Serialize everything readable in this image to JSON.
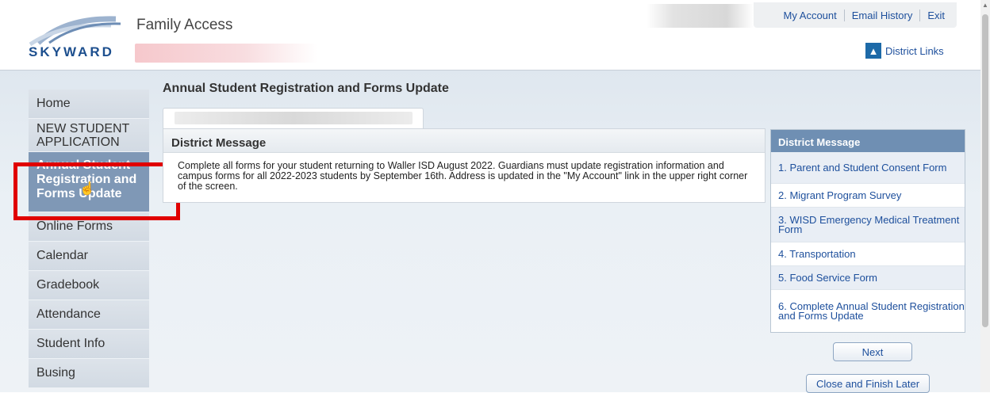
{
  "header": {
    "logo_text": "SKYWARD",
    "app_title": "Family Access",
    "top_links": [
      "My Account",
      "Email History",
      "Exit"
    ],
    "district_links_label": "District Links"
  },
  "page_title": "Annual Student Registration and Forms Update",
  "sidebar": {
    "items": [
      {
        "label": "Home"
      },
      {
        "label": "NEW STUDENT APPLICATION"
      },
      {
        "label": "Annual Student Registration and Forms Update",
        "active": true
      },
      {
        "label": "Online Forms"
      },
      {
        "label": "Calendar"
      },
      {
        "label": "Gradebook"
      },
      {
        "label": "Attendance"
      },
      {
        "label": "Student Info"
      },
      {
        "label": "Busing"
      }
    ]
  },
  "message": {
    "heading": "District Message",
    "body": "Complete all forms for your student returning to Waller ISD August 2022. Guardians must update registration information and campus forms for all 2022-2023 students by September 16th. Address is updated in the \"My Account\" link in the upper right corner of the screen."
  },
  "steps": {
    "heading": "District Message",
    "items": [
      "1. Parent and Student Consent Form",
      "2. Migrant Program Survey",
      "3. WISD Emergency Medical Treatment Form",
      "4. Transportation",
      "5. Food Service Form",
      "6. Complete Annual Student Registration and Forms Update"
    ]
  },
  "buttons": {
    "next": "Next",
    "close": "Close and Finish Later"
  },
  "colors": {
    "link": "#1d4f9c",
    "active_nav": "#7f98b6",
    "panel_header": "#6f8fb3",
    "highlight_box": "#e00000"
  },
  "icons": {
    "district_links": "building-icon",
    "cursor": "hand-pointer-icon"
  }
}
